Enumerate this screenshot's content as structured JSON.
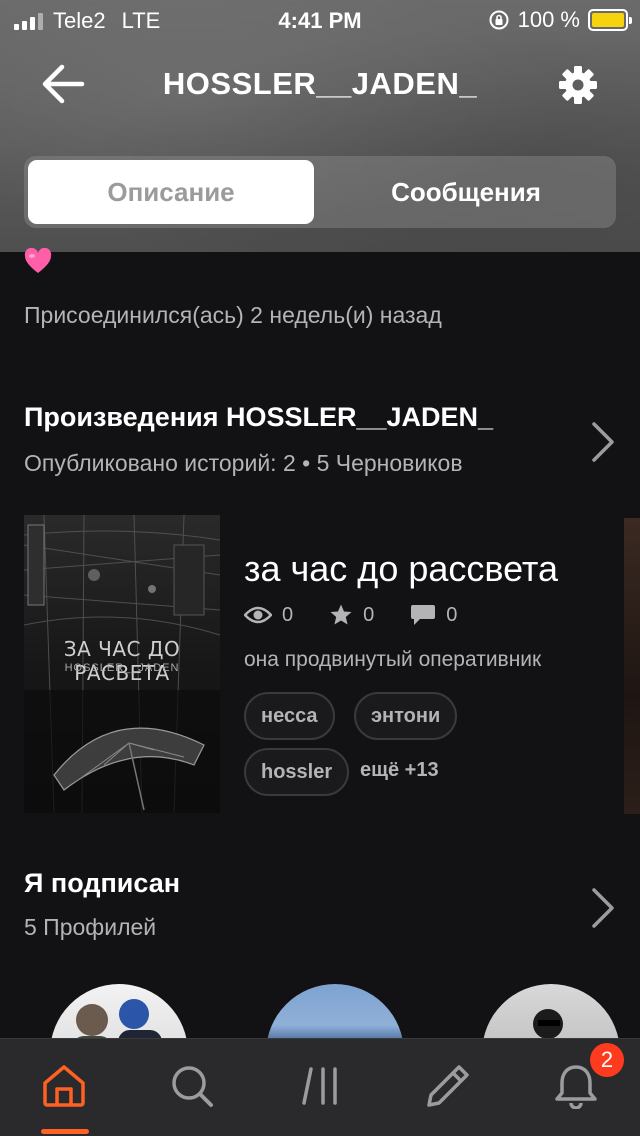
{
  "status_bar": {
    "carrier": "Tele2",
    "network": "LTE",
    "time": "4:41 PM",
    "battery_percent": "100 %",
    "battery_color": "#f5d30f"
  },
  "nav": {
    "title": "HOSSLER__JADEN_",
    "back_icon": "arrow-left-icon",
    "settings_icon": "gear-icon"
  },
  "tabs": {
    "description": "Описание",
    "messages": "Сообщения",
    "active": "description"
  },
  "profile": {
    "heart_emoji_color": "#ff5fa8",
    "joined": "Присоединился(ась) 2 недель(и) назад"
  },
  "works": {
    "title": "Произведения HOSSLER__JADEN_",
    "subtitle": "Опубликовано историй: 2 • 5 Черновиков",
    "story": {
      "cover_title": "ЗА ЧАС ДО РАСВЕТА",
      "cover_author": "HOSSLER__JADEN",
      "title": "за час до рассвета",
      "views": "0",
      "votes": "0",
      "comments": "0",
      "description": "она продвинутый оперативник",
      "tags": [
        "несса",
        "энтони",
        "hossler"
      ],
      "more_tags": "ещё +13"
    }
  },
  "following": {
    "title": "Я подписан",
    "subtitle": "5 Профилей"
  },
  "tabbar": {
    "items": [
      "home-icon",
      "search-icon",
      "library-icon",
      "write-icon",
      "notifications-icon"
    ],
    "active": "home-icon",
    "accent": "#ff6122",
    "notification_count": "2"
  }
}
